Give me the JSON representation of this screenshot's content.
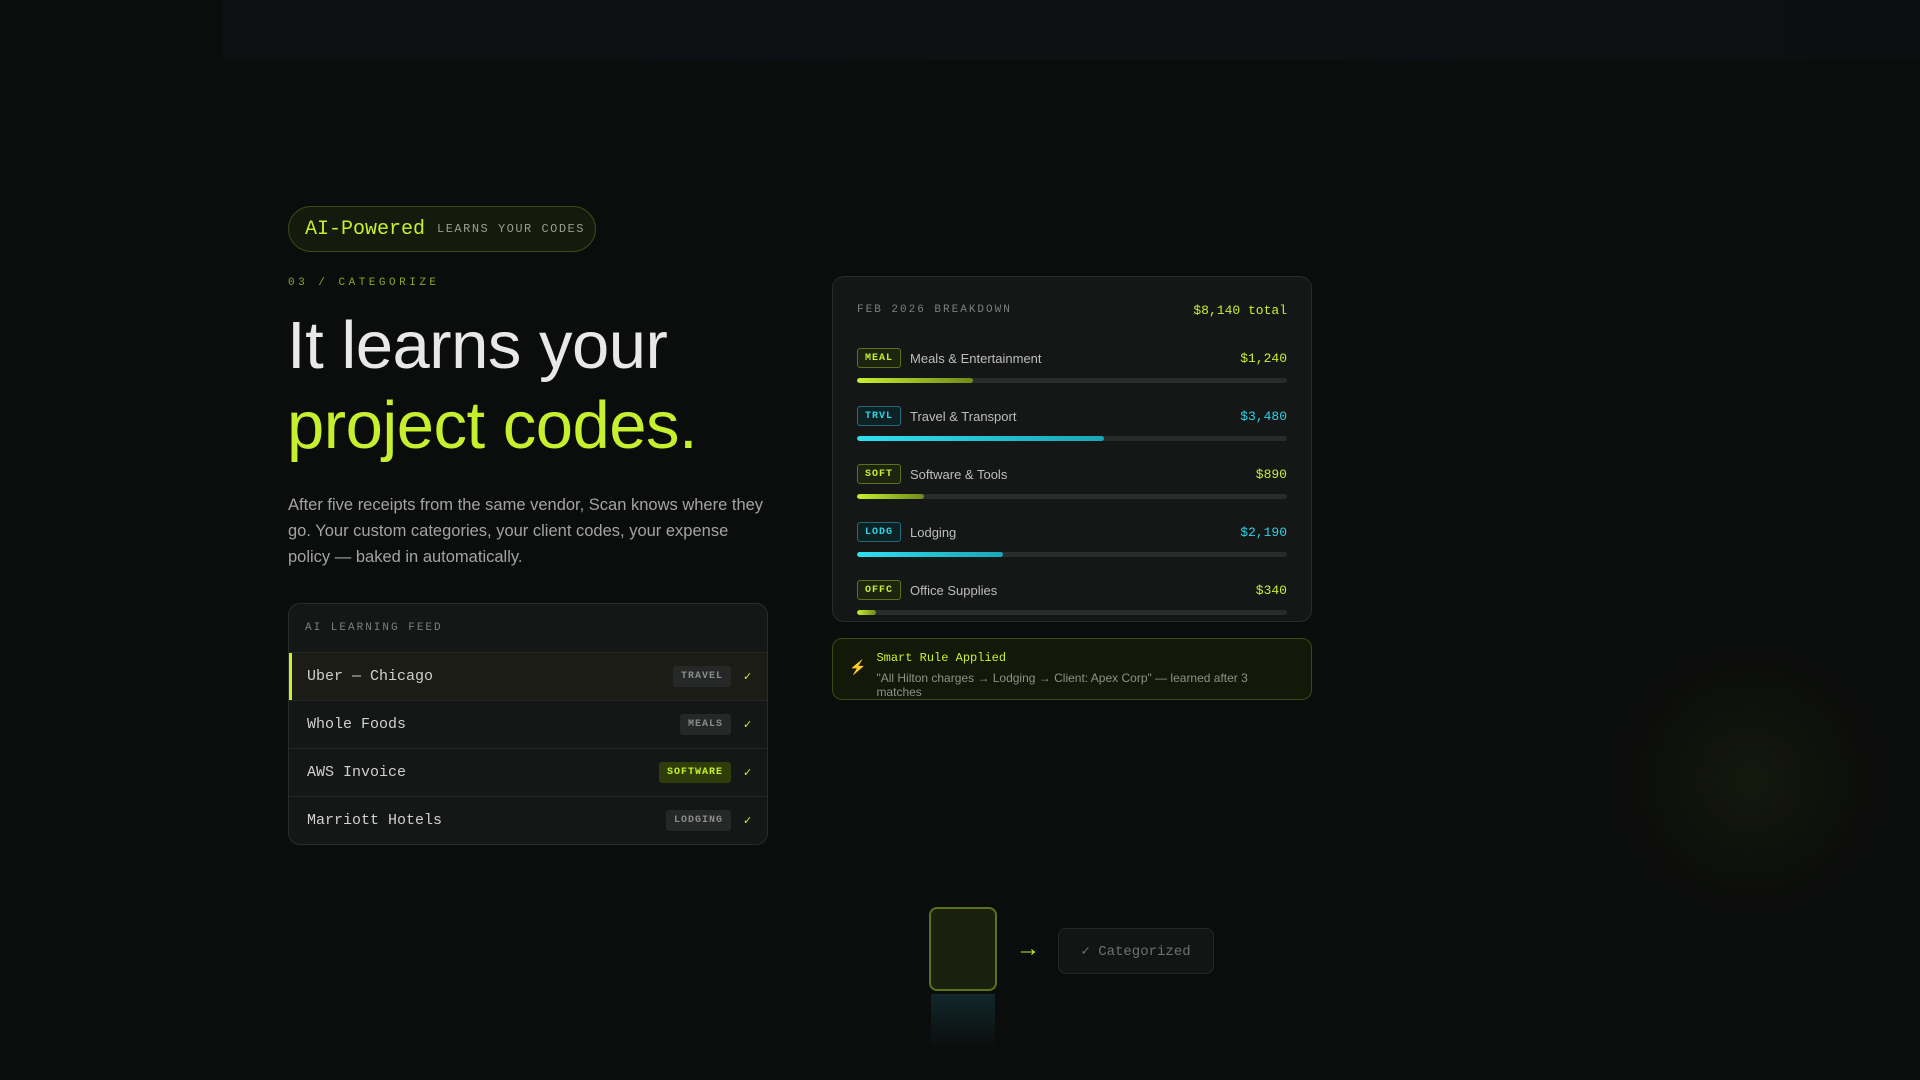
{
  "badge": {
    "main": "AI-Powered",
    "sub": "LEARNS YOUR CODES"
  },
  "section_label": "03 / CATEGORIZE",
  "headline": {
    "line1": "It learns your",
    "line2": "project codes."
  },
  "description": "After five receipts from the same vendor, Scan knows where they go. Your custom categories, your client codes, your expense policy — baked in automatically.",
  "feed": {
    "title": "AI LEARNING FEED",
    "items": [
      {
        "name": "Uber — Chicago",
        "tag": "TRAVEL",
        "check": "✓"
      },
      {
        "name": "Whole Foods",
        "tag": "MEALS",
        "check": "✓"
      },
      {
        "name": "AWS Invoice",
        "tag": "SOFTWARE",
        "check": "✓"
      },
      {
        "name": "Marriott Hotels",
        "tag": "LODGING",
        "check": "✓"
      }
    ]
  },
  "breakdown": {
    "title": "FEB 2026 BREAKDOWN",
    "total": "$8,140 total",
    "rows": [
      {
        "code": "MEAL",
        "name": "Meals & Entertainment",
        "amount": "$1,240",
        "share": 0.27
      },
      {
        "code": "TRVL",
        "name": "Travel & Transport",
        "amount": "$3,480",
        "share": 0.575
      },
      {
        "code": "SOFT",
        "name": "Software & Tools",
        "amount": "$890",
        "share": 0.155
      },
      {
        "code": "LODG",
        "name": "Lodging",
        "amount": "$2,190",
        "share": 0.34
      },
      {
        "code": "OFFC",
        "name": "Office Supplies",
        "amount": "$340",
        "share": 0.045
      }
    ]
  },
  "smart_rule": {
    "icon": "lightning-icon",
    "title": "Smart Rule Applied",
    "text": "\"All Hilton charges → Lodging → Client: Apex Corp\" — learned after 3 matches"
  },
  "flow": {
    "arrow": "→",
    "status": "✓ Categorized"
  },
  "colors": {
    "accent": "#c6f02e",
    "cyan": "#2fd3e6",
    "background": "#0b0c0c"
  }
}
